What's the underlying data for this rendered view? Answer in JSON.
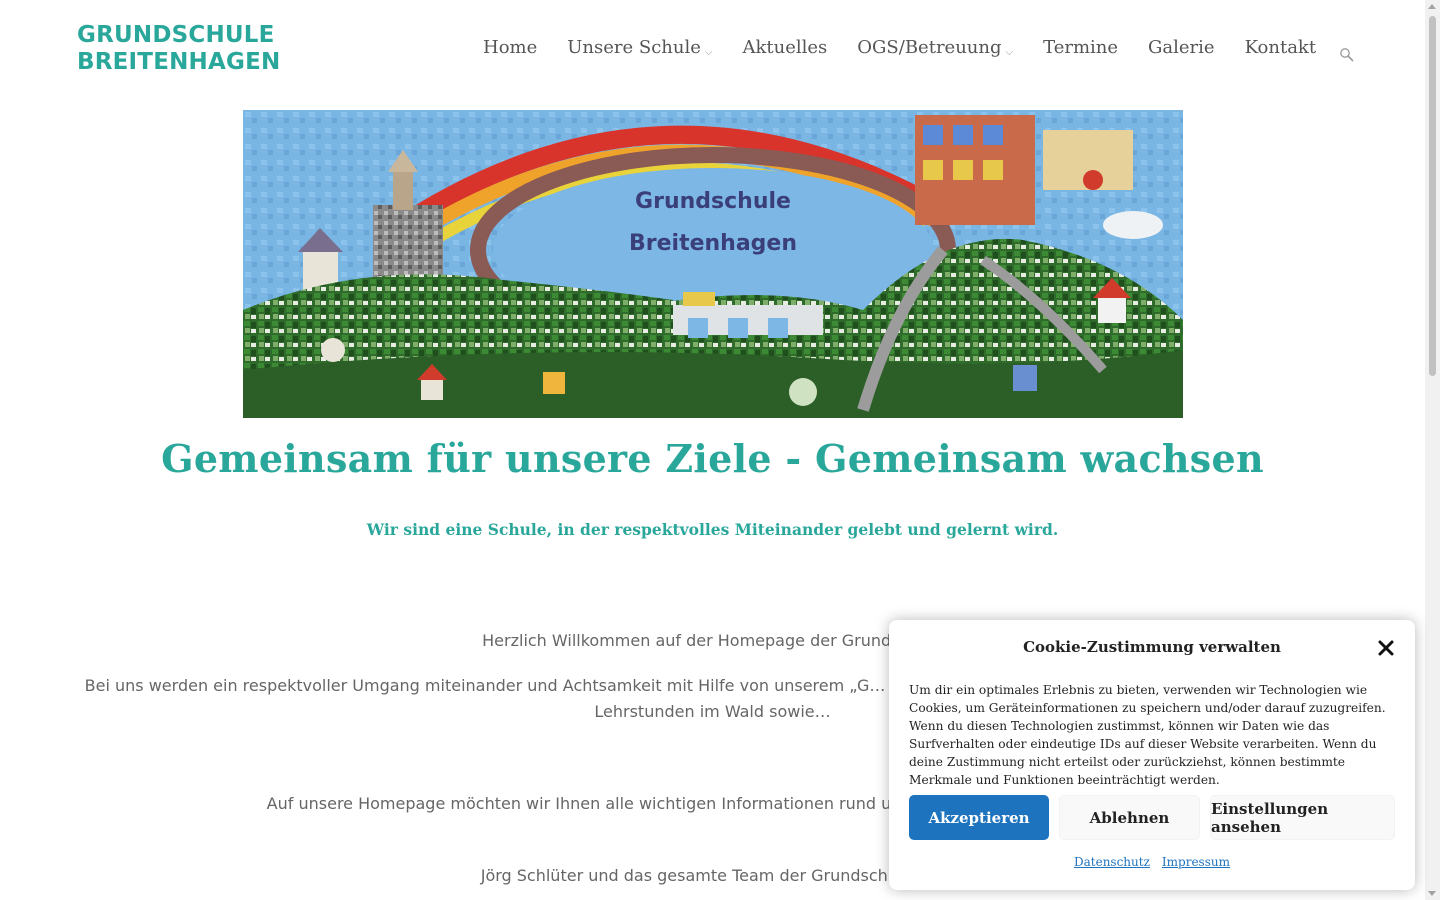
{
  "brand": {
    "line1": "GRUNDSCHULE",
    "line2": "BREITENHAGEN",
    "accent_color": "#2aa79b"
  },
  "nav": {
    "items": [
      {
        "label": "Home",
        "has_dropdown": false
      },
      {
        "label": "Unsere Schule",
        "has_dropdown": true
      },
      {
        "label": "Aktuelles",
        "has_dropdown": false
      },
      {
        "label": "OGS/Betreuung",
        "has_dropdown": true
      },
      {
        "label": "Termine",
        "has_dropdown": false
      },
      {
        "label": "Galerie",
        "has_dropdown": false
      },
      {
        "label": "Kontakt",
        "has_dropdown": false
      }
    ],
    "search_icon": "search-icon",
    "dropdown_icon": "chevron-down-icon",
    "caret_glyph": "⌵"
  },
  "hero": {
    "image_text_line1": "Grundschule",
    "image_text_line2": "Breitenhagen"
  },
  "main": {
    "headline": "Gemeinsam für unsere Ziele - Gemeinsam wachsen",
    "subline": "Wir sind eine Schule, in der respektvolles Miteinander gelebt und gelernt wird.",
    "paragraphs": [
      "Herzlich Willkommen auf der Homepage der Grundschule",
      "Bei uns werden ein respektvoller Umgang miteinander und Achtsamkeit mit Hilfe von unserem „G… unmittelbare Waldrandlage ermöglicht uns so achtsame Lehrstunden im Wald sowie…",
      "Auf unsere Homepage möchten wir Ihnen alle wichtigen Informationen rund um unsere Schule, das S… stellen.",
      "Jörg Schlüter und das gesamte Team der Grundschule B…"
    ]
  },
  "cookie": {
    "title": "Cookie-Zustimmung verwalten",
    "close_icon": "close-icon",
    "close_glyph": "✕",
    "text": "Um dir ein optimales Erlebnis zu bieten, verwenden wir Technologien wie Cookies, um Geräteinformationen zu speichern und/oder darauf zuzugreifen. Wenn du diesen Technologien zustimmst, können wir Daten wie das Surfverhalten oder eindeutige IDs auf dieser Website verarbeiten. Wenn du deine Zustimmung nicht erteilst oder zurückziehst, können bestimmte Merkmale und Funktionen beeinträchtigt werden.",
    "accept_label": "Akzeptieren",
    "deny_label": "Ablehnen",
    "settings_label": "Einstellungen ansehen",
    "privacy_link": "Datenschutz",
    "imprint_link": "Impressum",
    "accept_color": "#1e73be"
  }
}
